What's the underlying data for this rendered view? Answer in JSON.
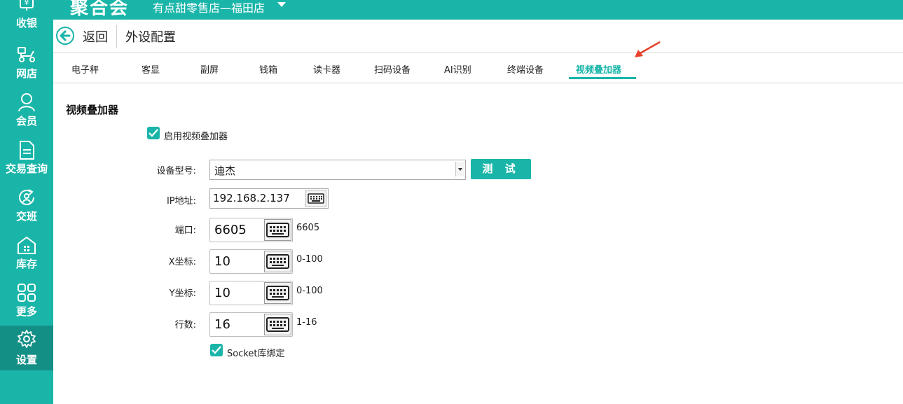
{
  "topbar": {
    "logo": "聚合会",
    "store_name": "有点甜零售店—福田店"
  },
  "sidebar": {
    "items": [
      {
        "label": "收银",
        "icon": "yen-register-icon"
      },
      {
        "label": "网店",
        "icon": "scooter-icon"
      },
      {
        "label": "会员",
        "icon": "member-icon"
      },
      {
        "label": "交易查询",
        "icon": "document-icon"
      },
      {
        "label": "交班",
        "icon": "shift-handover-icon"
      },
      {
        "label": "库存",
        "icon": "warehouse-icon"
      },
      {
        "label": "更多",
        "icon": "grid-icon"
      },
      {
        "label": "设置",
        "icon": "gear-icon",
        "active": true
      }
    ]
  },
  "header": {
    "back_label": "返回",
    "title": "外设配置"
  },
  "tabs": [
    {
      "label": "电子秤"
    },
    {
      "label": "客显"
    },
    {
      "label": "副屏"
    },
    {
      "label": "钱箱"
    },
    {
      "label": "读卡器"
    },
    {
      "label": "扫码设备"
    },
    {
      "label": "AI识别"
    },
    {
      "label": "终端设备"
    },
    {
      "label": "视频叠加器",
      "active": true
    }
  ],
  "form": {
    "section_title": "视频叠加器",
    "enable_label": "启用视频叠加器",
    "enable_checked": true,
    "device_model_label": "设备型号:",
    "device_model_value": "迪杰",
    "test_button": "测 试",
    "ip_label": "IP地址:",
    "ip_value": "192.168.2.137",
    "port_label": "端口:",
    "port_value": "6605",
    "port_hint": "6605",
    "x_label": "X坐标:",
    "x_value": "10",
    "x_range": "0-100",
    "y_label": "Y坐标:",
    "y_value": "10",
    "y_range": "0-100",
    "rows_label": "行数:",
    "rows_value": "16",
    "rows_range": "1-16",
    "socket_label": "Socket库绑定",
    "socket_checked": true
  },
  "colors": {
    "accent": "#1ab5a9",
    "accent_dark": "#138f86",
    "arrow": "#e8412c"
  }
}
